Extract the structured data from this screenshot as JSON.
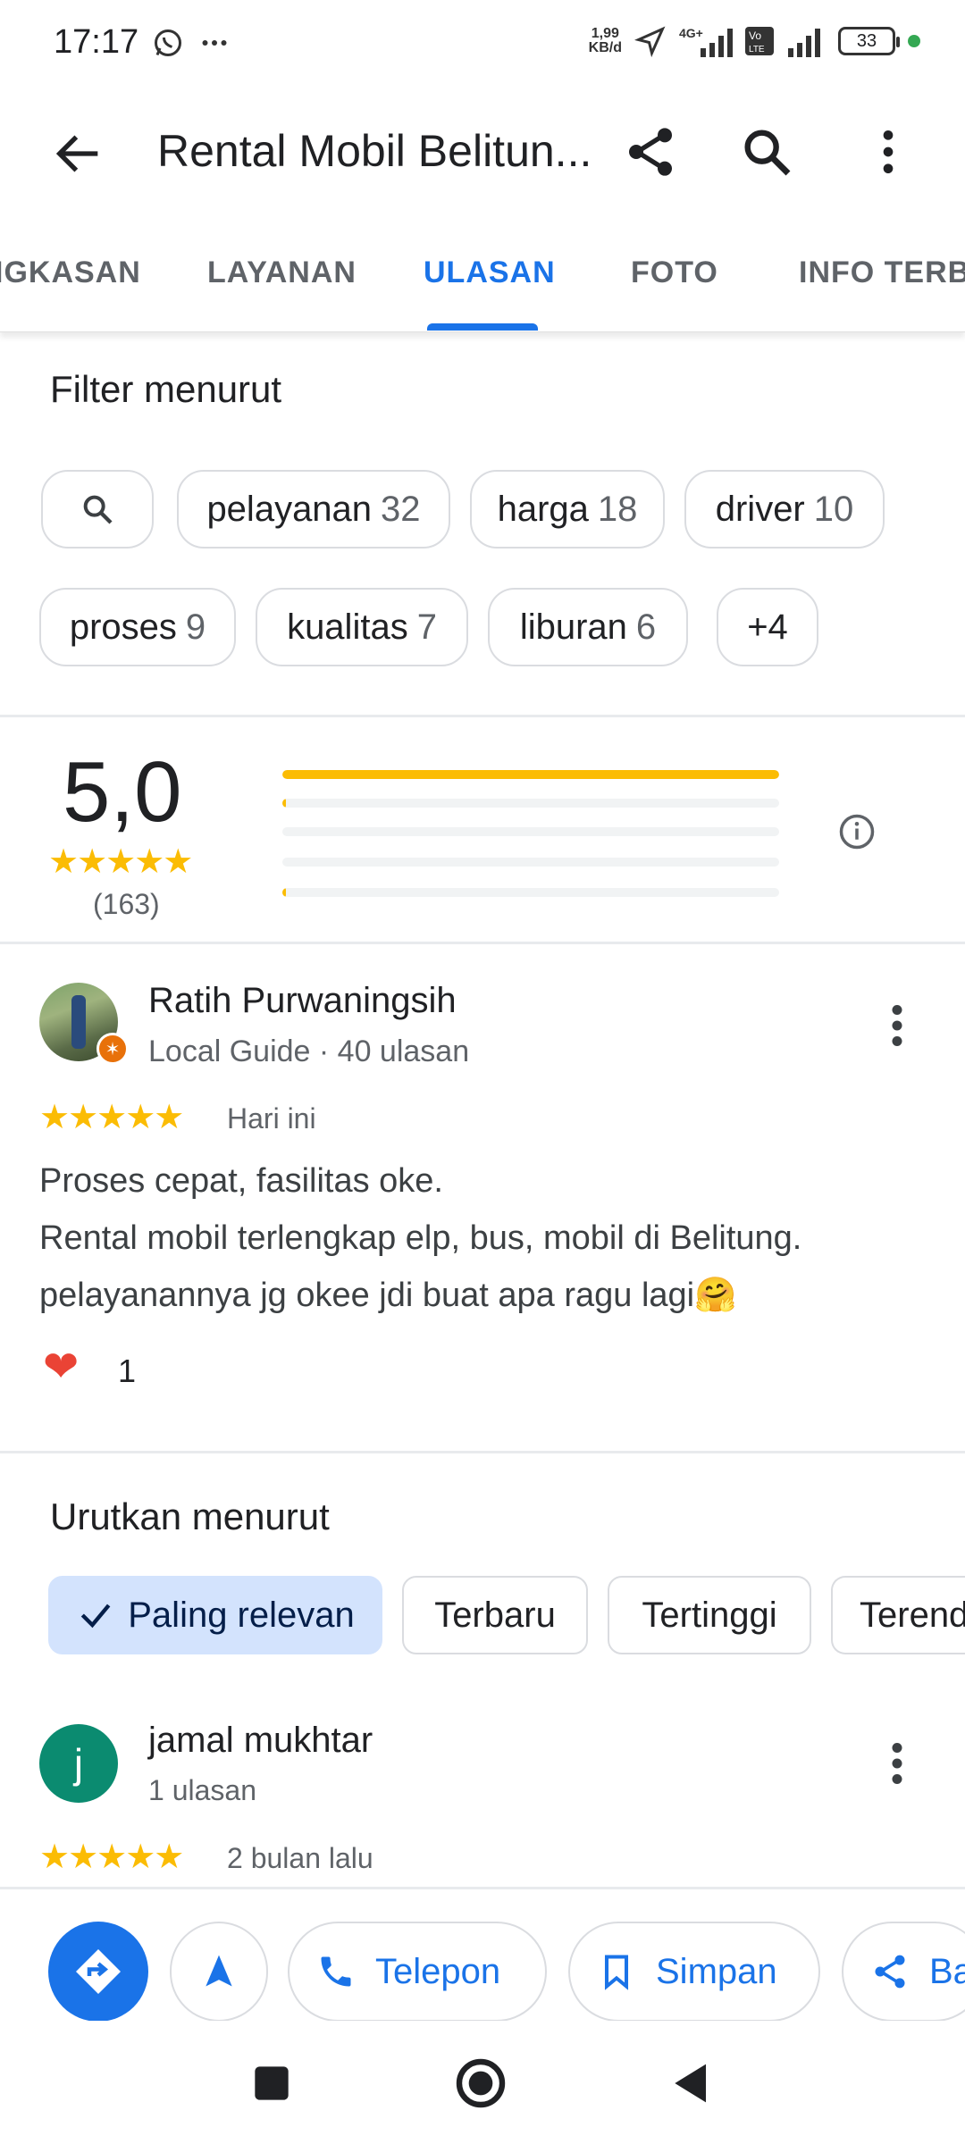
{
  "status_bar": {
    "time": "17:17",
    "speed": "1,99\nKB/d",
    "network": "4G+",
    "battery": "33"
  },
  "app_bar": {
    "title": "Rental Mobil Belitun..."
  },
  "tabs": [
    {
      "label": "RINGKASAN",
      "visible": "IGKASAN"
    },
    {
      "label": "LAYANAN"
    },
    {
      "label": "ULASAN",
      "active": true
    },
    {
      "label": "FOTO"
    },
    {
      "label": "INFO TERBARU",
      "visible": "INFO TERBA"
    }
  ],
  "filter": {
    "title": "Filter menurut",
    "chips": [
      {
        "label": "pelayanan",
        "count": "32"
      },
      {
        "label": "harga",
        "count": "18"
      },
      {
        "label": "driver",
        "count": "10"
      },
      {
        "label": "proses",
        "count": "9"
      },
      {
        "label": "kualitas",
        "count": "7"
      },
      {
        "label": "liburan",
        "count": "6"
      },
      {
        "label": "+4",
        "count": ""
      }
    ]
  },
  "rating": {
    "value": "5,0",
    "stars": "★★★★★",
    "count": "(163)",
    "distribution": [
      1.0,
      0.006,
      0,
      0,
      0.006
    ]
  },
  "review1": {
    "name": "Ratih Purwaningsih",
    "meta": "Local Guide · 40 ulasan",
    "stars": "★★★★★",
    "date": "Hari ini",
    "lines": [
      "Proses cepat, fasilitas oke.",
      "Rental mobil terlengkap elp, bus, mobil di Belitung.",
      "pelayanannya jg okee jdi buat apa ragu lagi🤗"
    ],
    "likes": "1"
  },
  "sort": {
    "title": "Urutkan menurut",
    "options": [
      "Paling relevan",
      "Terbaru",
      "Tertinggi",
      "Terendah"
    ],
    "selected": "Paling relevan"
  },
  "review2": {
    "initial": "j",
    "name": "jamal mukhtar",
    "meta": "1 ulasan",
    "stars": "★★★★★",
    "date": "2 bulan lalu"
  },
  "actions": {
    "call": "Telepon",
    "save": "Simpan",
    "share": "Bagikan"
  },
  "colors": {
    "accent": "#1a73e8",
    "star": "#fbbc04",
    "selected_chip": "#d3e3fd",
    "avatar_letter_bg": "#0b8b70"
  }
}
